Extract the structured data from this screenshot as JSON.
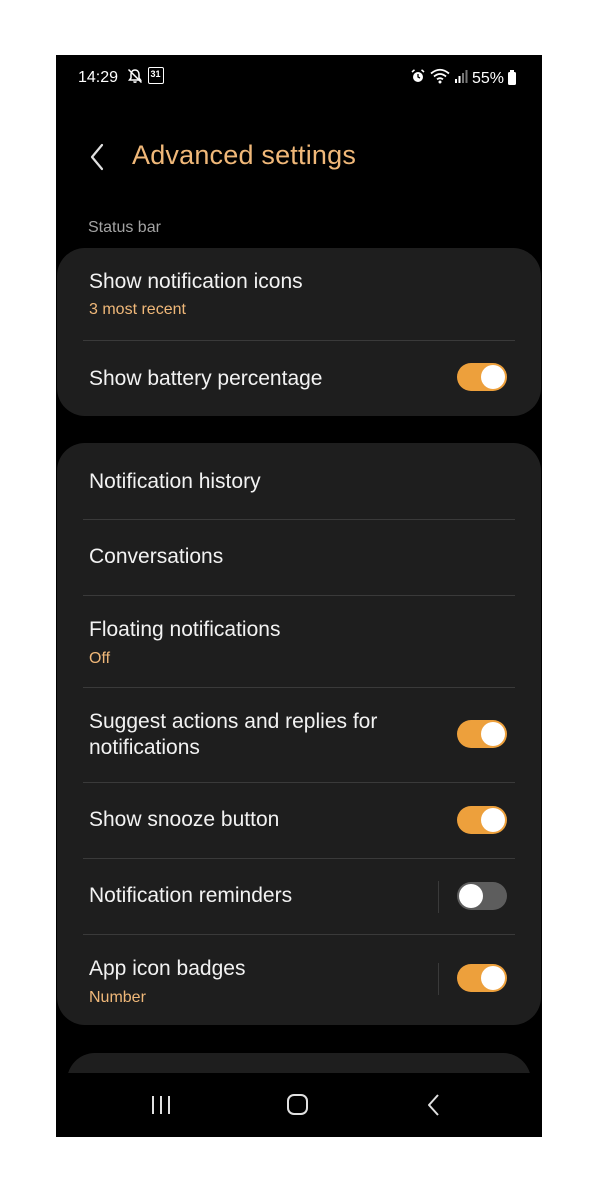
{
  "status_bar": {
    "time": "14:29",
    "battery_percent": "55%",
    "left_icons": [
      "notifications-off-icon",
      "calendar-icon"
    ],
    "calendar_day": "31",
    "right_icons": [
      "alarm-icon",
      "wifi-icon",
      "signal-icon",
      "battery-icon"
    ]
  },
  "header": {
    "title": "Advanced settings",
    "back_icon": "chevron-left-icon"
  },
  "colors": {
    "accent": "#f0b879",
    "toggle_on": "#eda03c",
    "card_bg": "#1e1e1e",
    "background": "#000000"
  },
  "status_bar_section": {
    "label": "Status bar",
    "items": [
      {
        "title": "Show notification icons",
        "subtitle": "3 most recent"
      },
      {
        "title": "Show battery percentage",
        "toggle": true
      }
    ]
  },
  "notifications_section": {
    "items": [
      {
        "title": "Notification history"
      },
      {
        "title": "Conversations"
      },
      {
        "title": "Floating notifications",
        "subtitle": "Off"
      },
      {
        "title": "Suggest actions and replies for notifications",
        "toggle": true
      },
      {
        "title": "Show snooze button",
        "toggle": true
      },
      {
        "title": "Notification reminders",
        "toggle": false
      },
      {
        "title": "App icon badges",
        "subtitle": "Number",
        "toggle": true
      }
    ]
  },
  "nav_bar": {
    "buttons": [
      "recents-icon",
      "home-icon",
      "back-icon"
    ]
  }
}
